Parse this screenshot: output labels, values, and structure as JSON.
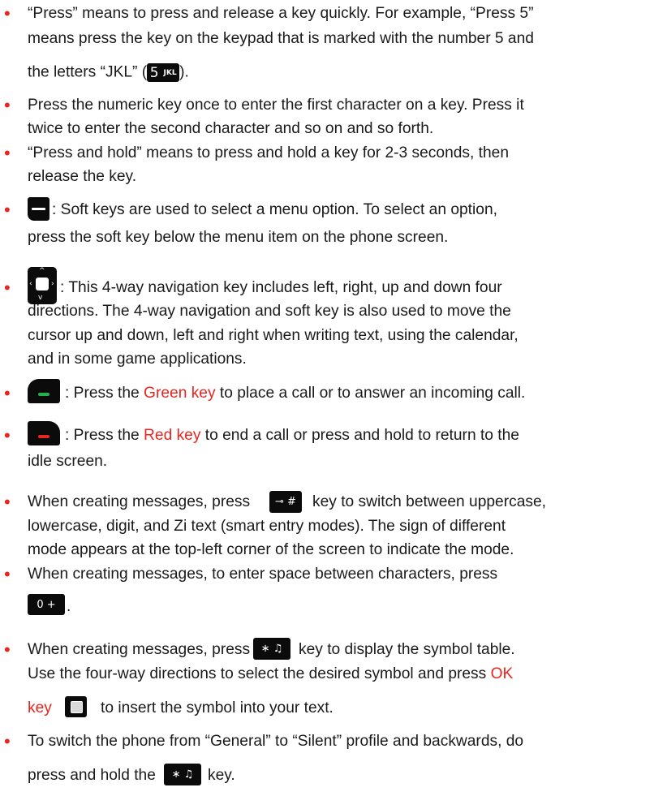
{
  "bullet_char": "•",
  "items": [
    {
      "lines": [
        "“Press” means to press and release a key quickly. For example, “Press 5”",
        "means press the key on the keypad that is marked with the number 5 and",
        "the letters “JKL” (",
        ")."
      ],
      "key": {
        "icon": "key-5-jkl-icon",
        "digit": "5",
        "letters": "JKL"
      }
    },
    {
      "lines": [
        "Press the numeric key once to enter the first character on a key. Press it",
        "twice to enter the second character and so on and so forth."
      ]
    },
    {
      "lines": [
        "“Press and hold” means to press and hold a key for 2-3 seconds, then",
        "release the key."
      ]
    },
    {
      "key": {
        "icon": "soft-key-icon"
      },
      "lines": [
        ": Soft keys are used to select a menu option. To select an option,",
        "press the soft key below the menu item on the phone screen."
      ]
    },
    {
      "key": {
        "icon": "navigation-key-icon"
      },
      "lines": [
        ": This 4-way navigation key includes left, right, up and down four",
        "directions. The 4-way navigation and soft key is also used to move the",
        "cursor up and down, left and right when writing text, using the calendar,",
        "and in some game applications."
      ]
    },
    {
      "key": {
        "icon": "green-key-icon",
        "color": "#22b14c"
      },
      "text_before": ": Press the ",
      "highlight": "Green key",
      "text_after": " to place a call or to answer an incoming call."
    },
    {
      "key": {
        "icon": "red-key-icon",
        "color": "#e8251f"
      },
      "text_before": ": Press the ",
      "highlight": "Red key",
      "text_after": " to end a call or press and hold to return to the",
      "line2": "idle screen."
    },
    {
      "text_before": "When creating messages, press",
      "key": {
        "icon": "hash-key-icon",
        "label": "⊸ #"
      },
      "text_after": "key to switch between uppercase,",
      "lines": [
        "lowercase, digit, and Zi text (smart entry modes). The sign of different",
        "mode appears at the top-left corner of the screen to indicate the mode."
      ]
    },
    {
      "text": "When creating messages, to enter space between characters, press",
      "key": {
        "icon": "zero-key-icon",
        "label": "0 +"
      },
      "text_after": "."
    },
    {
      "text_before": "When creating messages, press",
      "key": {
        "icon": "star-key-icon",
        "label": "∗ ♫"
      },
      "text_after": "key to display the symbol table.",
      "line2_before": "Use the four-way directions to select the desired symbol and press ",
      "line2_highlight": "OK",
      "line3_highlight": "key",
      "ok_key": {
        "icon": "ok-key-icon"
      },
      "line3_after": "to insert the symbol into your text."
    },
    {
      "line1": "To switch the phone from “General” to “Silent” profile and backwards, do",
      "line2_before": "press and hold the",
      "key": {
        "icon": "star-key-icon",
        "label": "∗ ♫"
      },
      "line2_after": "key."
    }
  ],
  "colors": {
    "accent_red": "#e8251f",
    "green": "#22b14c",
    "key_black": "#0b0b0b"
  }
}
